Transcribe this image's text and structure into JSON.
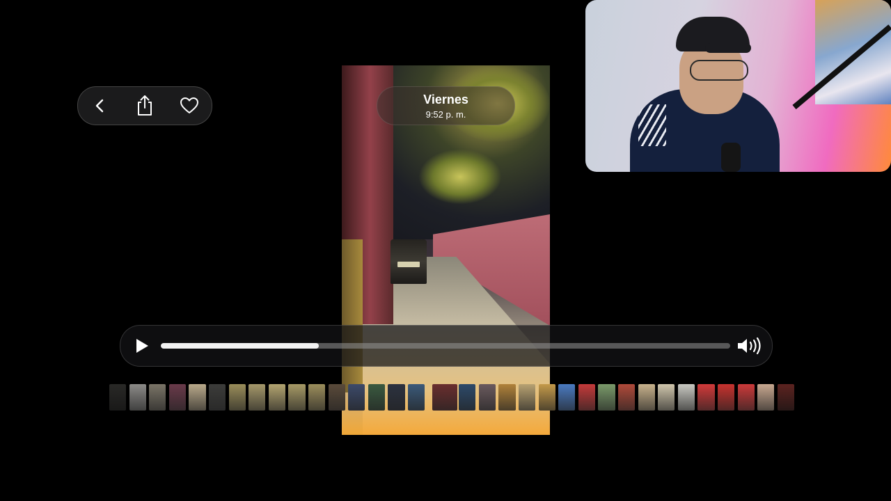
{
  "toolbar": {
    "back_icon": "chevron-left-icon",
    "share_icon": "share-icon",
    "favorite_icon": "heart-icon"
  },
  "photo": {
    "day": "Viernes",
    "time": "9:52 p. m."
  },
  "player": {
    "play_icon": "play-icon",
    "volume_icon": "speaker-icon",
    "progress": 0.277
  },
  "thumbnails": [
    {
      "color": "#4b4a46"
    },
    {
      "color": "#8c8b88"
    },
    {
      "color": "#7a7467"
    },
    {
      "color": "#6a3a4a"
    },
    {
      "color": "#b9a98a"
    },
    {
      "color": "#3c3c3a"
    },
    {
      "color": "#9a8d5a"
    },
    {
      "color": "#a5986a"
    },
    {
      "color": "#b3a470"
    },
    {
      "color": "#a79a66"
    },
    {
      "color": "#9c8e5c"
    },
    {
      "color": "#5a4a3a"
    },
    {
      "color": "#3c4a6a"
    },
    {
      "color": "#3a5a40"
    },
    {
      "color": "#2c3240"
    },
    {
      "color": "#3b5a7a"
    },
    {
      "color": "#6a2e2e"
    },
    {
      "color": "#2d4a6a"
    },
    {
      "color": "#6a5a5e"
    },
    {
      "color": "#b0823a"
    },
    {
      "color": "#b8a272"
    },
    {
      "color": "#c49a4a"
    },
    {
      "color": "#4a7ac0"
    },
    {
      "color": "#c43a3a"
    },
    {
      "color": "#7a9a6a"
    },
    {
      "color": "#b04a3a"
    },
    {
      "color": "#c8b28c"
    },
    {
      "color": "#d0c6ac"
    },
    {
      "color": "#c9c9c2"
    },
    {
      "color": "#d23a3a"
    },
    {
      "color": "#c8322e"
    },
    {
      "color": "#cc3a3a"
    },
    {
      "color": "#c8a890"
    },
    {
      "color": "#a8403a"
    }
  ]
}
